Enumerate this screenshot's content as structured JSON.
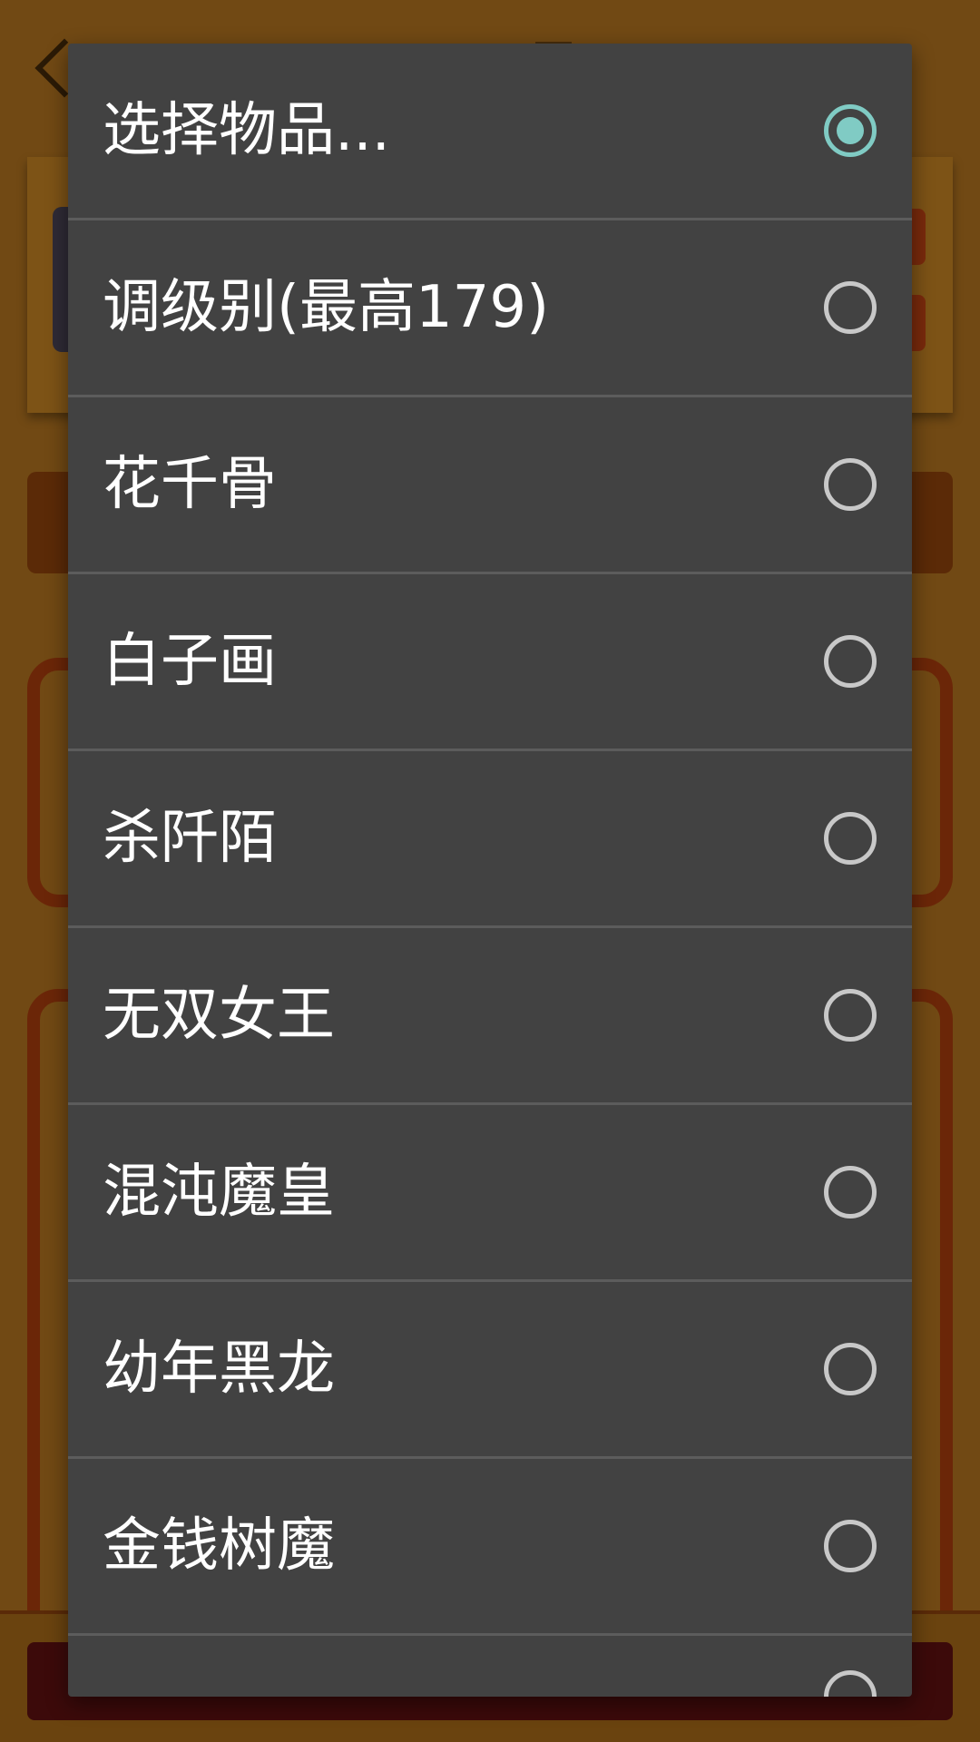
{
  "dialog": {
    "options": [
      {
        "label": "选择物品...",
        "selected": true
      },
      {
        "label": "调级别(最高179)",
        "selected": false
      },
      {
        "label": "花千骨",
        "selected": false
      },
      {
        "label": "白子画",
        "selected": false
      },
      {
        "label": "杀阡陌",
        "selected": false
      },
      {
        "label": "无双女王",
        "selected": false
      },
      {
        "label": "混沌魔皇",
        "selected": false
      },
      {
        "label": "幼年黑龙",
        "selected": false
      },
      {
        "label": "金钱树魔",
        "selected": false
      }
    ]
  },
  "colors": {
    "dialog_bg": "#424242",
    "accent": "#80cbc4",
    "radio_unselected": "#c8c8c8",
    "divider": "#5c5c5c",
    "text": "#ffffff"
  }
}
